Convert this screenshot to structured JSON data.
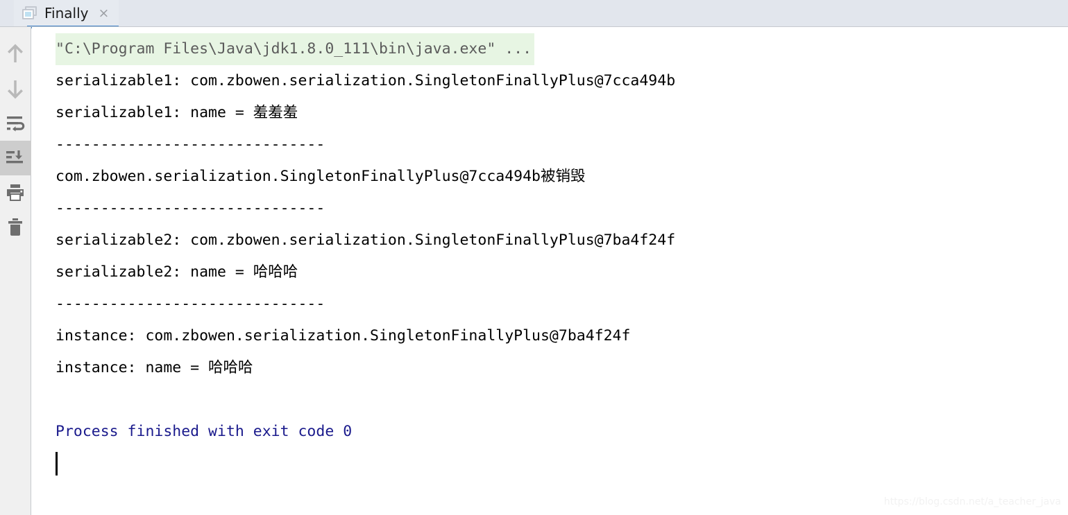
{
  "window": {
    "tab": {
      "label": "Finally",
      "close_label": "×",
      "icon": "console-window-icon"
    }
  },
  "toolbar": {
    "items": [
      {
        "name": "up-arrow-icon",
        "tooltip": "Up the stack trace",
        "selected": false
      },
      {
        "name": "down-arrow-icon",
        "tooltip": "Down the stack trace",
        "selected": false
      },
      {
        "name": "soft-wrap-icon",
        "tooltip": "Soft-Wrap",
        "selected": false
      },
      {
        "name": "scroll-to-end-icon",
        "tooltip": "Scroll to the end",
        "selected": true
      },
      {
        "name": "print-icon",
        "tooltip": "Print",
        "selected": false
      },
      {
        "name": "trash-icon",
        "tooltip": "Clear All",
        "selected": false
      }
    ]
  },
  "console": {
    "lines": [
      {
        "id": "cmd",
        "text": "\"C:\\Program Files\\Java\\jdk1.8.0_111\\bin\\java.exe\" ...",
        "style": "cmd"
      },
      {
        "id": "l2",
        "text": "serializable1: com.zbowen.serialization.SingletonFinallyPlus@7cca494b",
        "style": "dark"
      },
      {
        "id": "l3",
        "text": "serializable1: name = 羞羞羞",
        "style": "dark"
      },
      {
        "id": "l4",
        "text": "------------------------------",
        "style": "dark"
      },
      {
        "id": "l5",
        "text": "com.zbowen.serialization.SingletonFinallyPlus@7cca494b被销毁",
        "style": "dark"
      },
      {
        "id": "l6",
        "text": "------------------------------",
        "style": "dark"
      },
      {
        "id": "l7",
        "text": "serializable2: com.zbowen.serialization.SingletonFinallyPlus@7ba4f24f",
        "style": "dark"
      },
      {
        "id": "l8",
        "text": "serializable2: name = 哈哈哈",
        "style": "dark"
      },
      {
        "id": "l9",
        "text": "------------------------------",
        "style": "dark"
      },
      {
        "id": "l10",
        "text": "instance: com.zbowen.serialization.SingletonFinallyPlus@7ba4f24f",
        "style": "dark"
      },
      {
        "id": "l11",
        "text": "instance: name = 哈哈哈",
        "style": "dark"
      },
      {
        "id": "l12",
        "text": " ",
        "style": "blank"
      },
      {
        "id": "l13",
        "text": "Process finished with exit code 0",
        "style": "navy"
      }
    ]
  },
  "watermark": {
    "text": "https://blog.csdn.net/a_teacher_java"
  },
  "colors": {
    "tabbar_bg": "#e2e6ed",
    "tab_active_underline": "#4083c9",
    "toolbar_bg": "#f0f0f0",
    "toolbar_selected_bg": "#cdcdcd",
    "console_bg": "#ffffff",
    "cmd_highlight_bg": "#e7f5e3",
    "cmd_text": "#5b5b5b",
    "output_text": "#000000",
    "exit_text": "#1a1a8c"
  }
}
